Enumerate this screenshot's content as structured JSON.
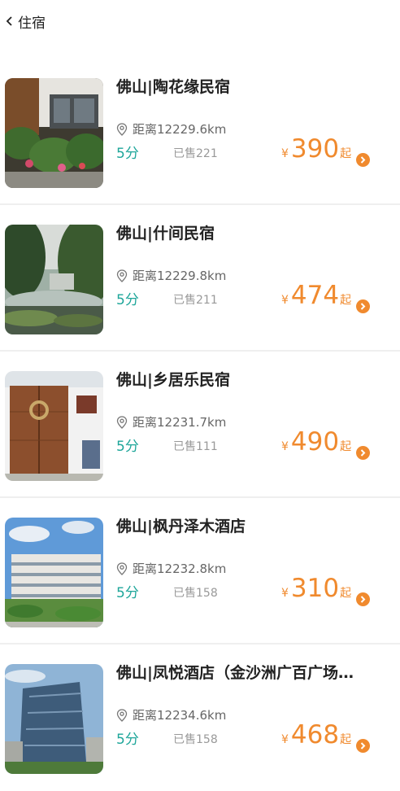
{
  "header": {
    "title": "住宿"
  },
  "hotels": [
    {
      "name": "佛山|陶花缘民宿",
      "distance": "距离12229.6km",
      "score": "5分",
      "sold": "已售221",
      "currency": "¥",
      "price": "390",
      "price_unit": "起"
    },
    {
      "name": "佛山|什间民宿",
      "distance": "距离12229.8km",
      "score": "5分",
      "sold": "已售211",
      "currency": "¥",
      "price": "474",
      "price_unit": "起"
    },
    {
      "name": "佛山|乡居乐民宿",
      "distance": "距离12231.7km",
      "score": "5分",
      "sold": "已售111",
      "currency": "¥",
      "price": "490",
      "price_unit": "起"
    },
    {
      "name": "佛山|枫丹泽木酒店",
      "distance": "距离12232.8km",
      "score": "5分",
      "sold": "已售158",
      "currency": "¥",
      "price": "310",
      "price_unit": "起"
    },
    {
      "name": "佛山|凤悦酒店（金沙洲广百广场…",
      "distance": "距离12234.6km",
      "score": "5分",
      "sold": "已售158",
      "currency": "¥",
      "price": "468",
      "price_unit": "起"
    }
  ],
  "colors": {
    "accent_price": "#f08a2e",
    "score_green": "#1ea69a",
    "muted": "#999999"
  }
}
